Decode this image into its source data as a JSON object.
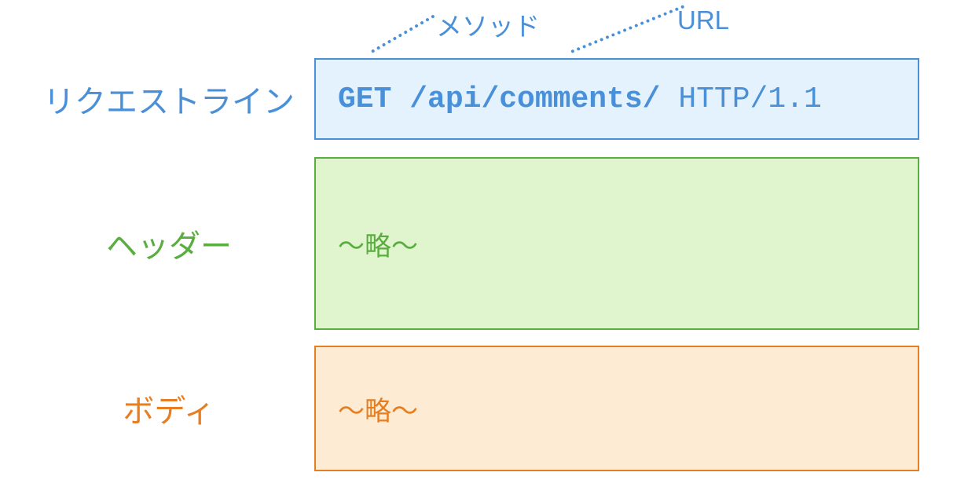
{
  "annotations": {
    "method": "メソッド",
    "url": "URL"
  },
  "rows": {
    "request": {
      "label": "リクエストライン",
      "method": "GET",
      "path": "/api/comments/",
      "protocol": "HTTP/1.1"
    },
    "header": {
      "label": "ヘッダー",
      "content": "〜略〜"
    },
    "body": {
      "label": "ボディ",
      "content": "〜略〜"
    }
  },
  "colors": {
    "blue": "#4a90d9",
    "green": "#5aad3f",
    "orange": "#e67e22"
  }
}
